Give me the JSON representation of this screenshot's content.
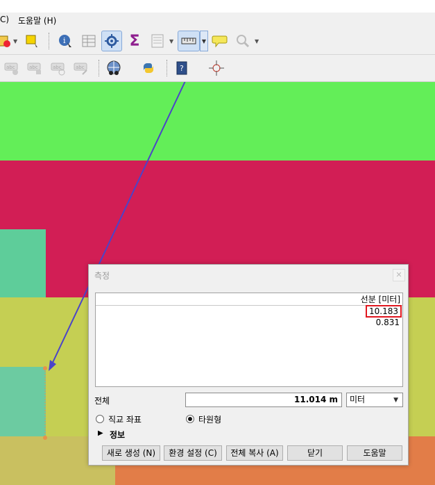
{
  "menubar": {
    "items": [
      {
        "label": "C)"
      },
      {
        "label": "도움말 (H)"
      }
    ]
  },
  "toolbar1": {
    "icons": [
      "select-by-location-icon",
      "select-features-icon",
      "identify-icon",
      "attribute-table-icon",
      "toggle-editing-icon",
      "statistics-sigma-icon",
      "open-attribute-table-icon",
      "measure-line-icon",
      "map-tips-icon",
      "zoom-to-selection-icon"
    ]
  },
  "toolbar2": {
    "icons": [
      "label-show-icon",
      "label-pin-icon",
      "label-move-icon",
      "label-rotate-icon",
      "plugins-globe-icon",
      "python-console-icon",
      "help-icon",
      "crosshair-icon"
    ]
  },
  "colors": {
    "green_region": "#63ee58",
    "crimson_region": "#d21e55",
    "teal_region": "#5ecd9a",
    "olive_region": "#c5cf53",
    "tan_region": "#c9c060",
    "orange_region": "#e27d48",
    "measure_line": "#4b44c8",
    "highlight": "#e0161e"
  },
  "dialog": {
    "title": "측정",
    "close": "✕",
    "segments_header": "선분 [미터]",
    "segments": [
      "10.183",
      "0.831"
    ],
    "total_label": "전체",
    "total_value": "11.014 m",
    "unit_selected": "미터",
    "radio_cartesian": "직교 좌표",
    "radio_ellipsoidal": "타원형",
    "info_label": "정보",
    "buttons": {
      "new": "새로 생성 (N)",
      "config": "환경 설정 (C)",
      "copy_all": "전체 복사 (A)",
      "close": "닫기",
      "help": "도움말"
    }
  }
}
